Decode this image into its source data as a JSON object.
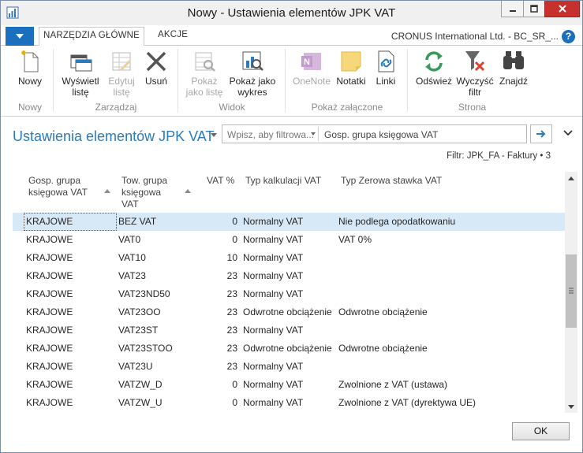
{
  "window": {
    "title": "Nowy - Ustawienia elementów JPK VAT"
  },
  "tabs": [
    {
      "label": "NARZĘDZIA GŁÓWNE"
    },
    {
      "label": "AKCJE"
    }
  ],
  "company": "CRONUS International Ltd. - BC_SR_...",
  "help_label": "?",
  "ribbon": {
    "buttons": {
      "nowy": "Nowy",
      "wyswietl": "Wyświetl listę",
      "edytuj": "Edytuj listę",
      "usun": "Usuń",
      "pokaz_liste": "Pokaż jako listę",
      "pokaz_wykres": "Pokaż jako wykres",
      "onenote": "OneNote",
      "notatki": "Notatki",
      "linki": "Linki",
      "odswiez": "Odśwież",
      "wyczysc": "Wyczyść filtr",
      "znajdz": "Znajdź"
    },
    "groups": {
      "nowy": "Nowy",
      "zarzadzaj": "Zarządzaj",
      "widok": "Widok",
      "pokaz_zalaczone": "Pokaż załączone",
      "strona": "Strona"
    }
  },
  "page": {
    "title": "Ustawienia elementów JPK VAT",
    "filter_placeholder": "Wpisz, aby filtrowa...",
    "filter_field": "Gosp. grupa księgowa VAT",
    "filter_summary": "Filtr: JPK_FA - Faktury • 3"
  },
  "grid": {
    "headers": {
      "col1": [
        "Gosp. grupa",
        "księgowa VAT"
      ],
      "col2": [
        "Tow. grupa",
        "księgowa",
        "VAT"
      ],
      "col3": "VAT %",
      "col4": "Typ kalkulacji VAT",
      "col5": "Typ Zerowa stawka VAT"
    },
    "rows": [
      {
        "gosp": "KRAJOWE",
        "tow": "BEZ VAT",
        "vat": "0",
        "typ": "Normalny VAT",
        "zero": "Nie podlega opodatkowaniu"
      },
      {
        "gosp": "KRAJOWE",
        "tow": "VAT0",
        "vat": "0",
        "typ": "Normalny VAT",
        "zero": "VAT 0%"
      },
      {
        "gosp": "KRAJOWE",
        "tow": "VAT10",
        "vat": "10",
        "typ": "Normalny VAT",
        "zero": ""
      },
      {
        "gosp": "KRAJOWE",
        "tow": "VAT23",
        "vat": "23",
        "typ": "Normalny VAT",
        "zero": ""
      },
      {
        "gosp": "KRAJOWE",
        "tow": "VAT23ND50",
        "vat": "23",
        "typ": "Normalny VAT",
        "zero": ""
      },
      {
        "gosp": "KRAJOWE",
        "tow": "VAT23OO",
        "vat": "23",
        "typ": "Odwrotne obciążenie",
        "zero": "Odwrotne obciążenie"
      },
      {
        "gosp": "KRAJOWE",
        "tow": "VAT23ST",
        "vat": "23",
        "typ": "Normalny VAT",
        "zero": ""
      },
      {
        "gosp": "KRAJOWE",
        "tow": "VAT23STOO",
        "vat": "23",
        "typ": "Odwrotne obciążenie",
        "zero": "Odwrotne obciążenie"
      },
      {
        "gosp": "KRAJOWE",
        "tow": "VAT23U",
        "vat": "23",
        "typ": "Normalny VAT",
        "zero": ""
      },
      {
        "gosp": "KRAJOWE",
        "tow": "VATZW_D",
        "vat": "0",
        "typ": "Normalny VAT",
        "zero": "Zwolnione z VAT (ustawa)"
      },
      {
        "gosp": "KRAJOWE",
        "tow": "VATZW_U",
        "vat": "0",
        "typ": "Normalny VAT",
        "zero": "Zwolnione z VAT (dyrektywa UE)"
      }
    ]
  },
  "ok_label": "OK",
  "colors": {
    "accent": "#2b7bbd",
    "menu_button": "#1a6fbf",
    "close_button": "#c7312d",
    "selected_row": "#d7e8f7"
  },
  "icons": [
    "app-icon",
    "minimize-icon",
    "maximize-icon",
    "close-icon",
    "menu-arrow-icon",
    "help-icon",
    "new-icon",
    "list-view-icon",
    "edit-list-icon",
    "delete-icon",
    "show-as-list-icon",
    "show-as-chart-icon",
    "onenote-icon",
    "notes-icon",
    "links-icon",
    "refresh-icon",
    "clear-filter-icon",
    "find-icon",
    "arrow-right-icon",
    "chevron-down-icon"
  ]
}
